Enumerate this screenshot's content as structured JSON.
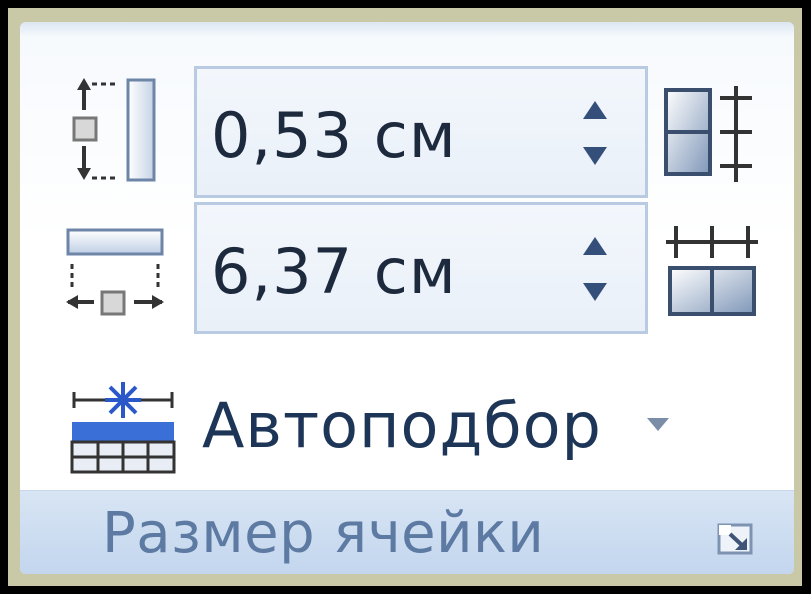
{
  "cell_size": {
    "height_field": {
      "value": "0,53 см"
    },
    "width_field": {
      "value": "6,37 см"
    },
    "autofit_label": "Автоподбор",
    "group_label": "Размер ячейки"
  },
  "icons": {
    "row_height": "row-height-icon",
    "column_width": "column-width-icon",
    "distribute_rows": "distribute-rows-icon",
    "distribute_columns": "distribute-columns-icon",
    "autofit": "autofit-icon",
    "dialog_launcher": "dialog-launcher-icon"
  },
  "colors": {
    "accent_blue": "#5d7aa3",
    "frame": "#c9c9a8",
    "field_border": "#b9cbe2"
  }
}
